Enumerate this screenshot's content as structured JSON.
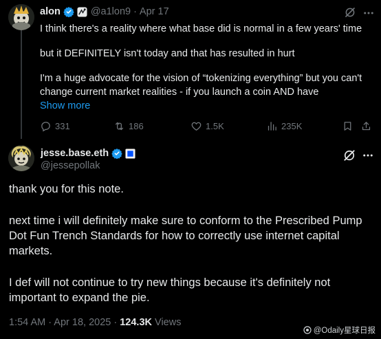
{
  "parent_tweet": {
    "author_name": "alon",
    "handle": "@a1lon9",
    "separator": "·",
    "date": "Apr 17",
    "lines": [
      "I think there's a reality where what base did is normal in a few years' time",
      "but it DEFINITELY isn't today and that has resulted in hurt",
      "I'm a huge advocate for the vision of “tokenizing everything” but you can't",
      "change current market realities - if you launch a coin AND have"
    ],
    "show_more": "Show more",
    "stats": {
      "replies": "331",
      "reposts": "186",
      "likes": "1.5K",
      "views": "235K"
    }
  },
  "main_tweet": {
    "author_name": "jesse.base.eth",
    "handle": "@jessepollak",
    "paragraphs": [
      [
        "thank you for this note."
      ],
      [
        "next time i will definitely make sure to conform to the Prescribed Pump",
        "Dot Fun Trench Standards for how to correctly use internet capital",
        "markets."
      ],
      [
        "I def will not continue to try new things because it's definitely not",
        "important to expand the pie."
      ]
    ],
    "time": "1:54 AM",
    "date": "Apr 18, 2025",
    "view_count": "124.3K",
    "views_label": "Views"
  },
  "watermark": "@Odaily星球日报",
  "colors": {
    "background": "#000000",
    "text": "#e7e9ea",
    "muted": "#71767b",
    "link": "#1d9bf0",
    "verified": "#1d9bf0"
  }
}
